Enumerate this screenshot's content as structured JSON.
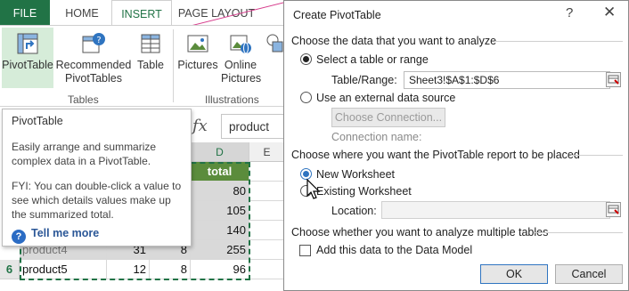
{
  "ribbon": {
    "tabs": {
      "file": "FILE",
      "home": "HOME",
      "insert": "INSERT",
      "page_layout": "PAGE LAYOUT"
    },
    "buttons": {
      "pivottable": "PivotTable",
      "recommended_line1": "Recommended",
      "recommended_line2": "PivotTables",
      "table": "Table",
      "pictures": "Pictures",
      "online_line1": "Online",
      "online_line2": "Pictures"
    },
    "groups": {
      "tables": "Tables",
      "illustrations": "Illustrations"
    }
  },
  "formula_bar": {
    "value": "product"
  },
  "tooltip": {
    "title": "PivotTable",
    "body1": "Easily arrange and summarize complex data in a PivotTable.",
    "body2": "FYI: You can double-click a value to see which details values make up the summarized total.",
    "tell_more": "Tell me more"
  },
  "grid": {
    "col_d": "D",
    "col_e": "E",
    "total_header": "total",
    "totals": [
      "80",
      "105",
      "140",
      "255",
      "96"
    ],
    "row5_name": "product4",
    "row5_b": "31",
    "row5_c": "8",
    "row6_header": "6",
    "row6_name": "product5",
    "row6_b": "12",
    "row6_c": "8"
  },
  "dialog": {
    "title": "Create PivotTable",
    "help_glyph": "?",
    "close_glyph": "✕",
    "section1": "Choose the data that you want to analyze",
    "opt_select_table": "Select a table or range",
    "table_range_label": "Table/Range:",
    "table_range_value": "Sheet3!$A$1:$D$6",
    "opt_external": "Use an external data source",
    "choose_connection": "Choose Connection...",
    "connection_name_label": "Connection name:",
    "section2": "Choose where you want the PivotTable report to be placed",
    "opt_new_ws": "New Worksheet",
    "opt_existing_ws": "Existing Worksheet",
    "location_label": "Location:",
    "section3": "Choose whether you want to analyze multiple tables",
    "add_data_model": "Add this data to the Data Model",
    "ok": "OK",
    "cancel": "Cancel"
  },
  "colors": {
    "excel_green": "#217346",
    "header_green": "#5b8c3c",
    "link_blue": "#2b5797",
    "highlight": "#d6ecd9"
  }
}
